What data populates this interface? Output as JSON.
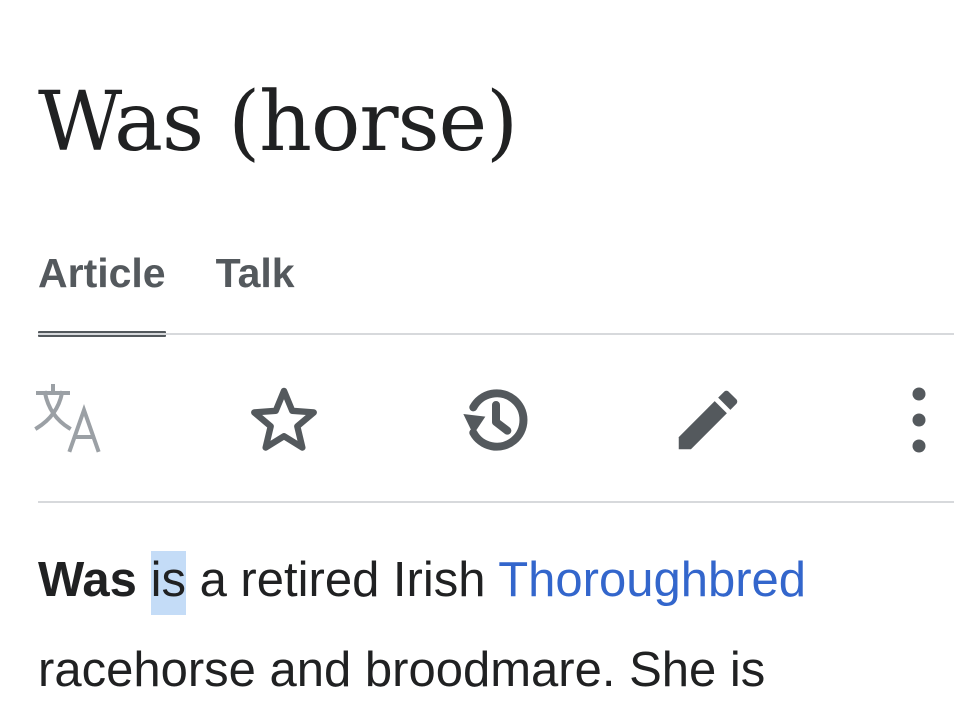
{
  "article": {
    "title": "Was (horse)"
  },
  "tabs": [
    {
      "label": "Article",
      "active": true
    },
    {
      "label": "Talk",
      "active": false
    }
  ],
  "toolbar": {
    "icons": [
      {
        "name": "language-icon"
      },
      {
        "name": "watch-star-icon"
      },
      {
        "name": "history-icon"
      },
      {
        "name": "edit-pencil-icon"
      },
      {
        "name": "more-options-icon"
      }
    ],
    "icon_color": "#54595d",
    "language_icon_color": "#9ba0a5"
  },
  "content": {
    "bold_term": "Was",
    "highlighted_word": "is",
    "text_after_highlight": " a retired Irish ",
    "link_text": "Thoroughbred",
    "line2": "racehorse and broodmare. She is"
  },
  "colors": {
    "text": "#202122",
    "link": "#3366cc",
    "selection": "#c4dcf7",
    "divider": "#d7d9dc",
    "tab_text": "#54595d"
  }
}
